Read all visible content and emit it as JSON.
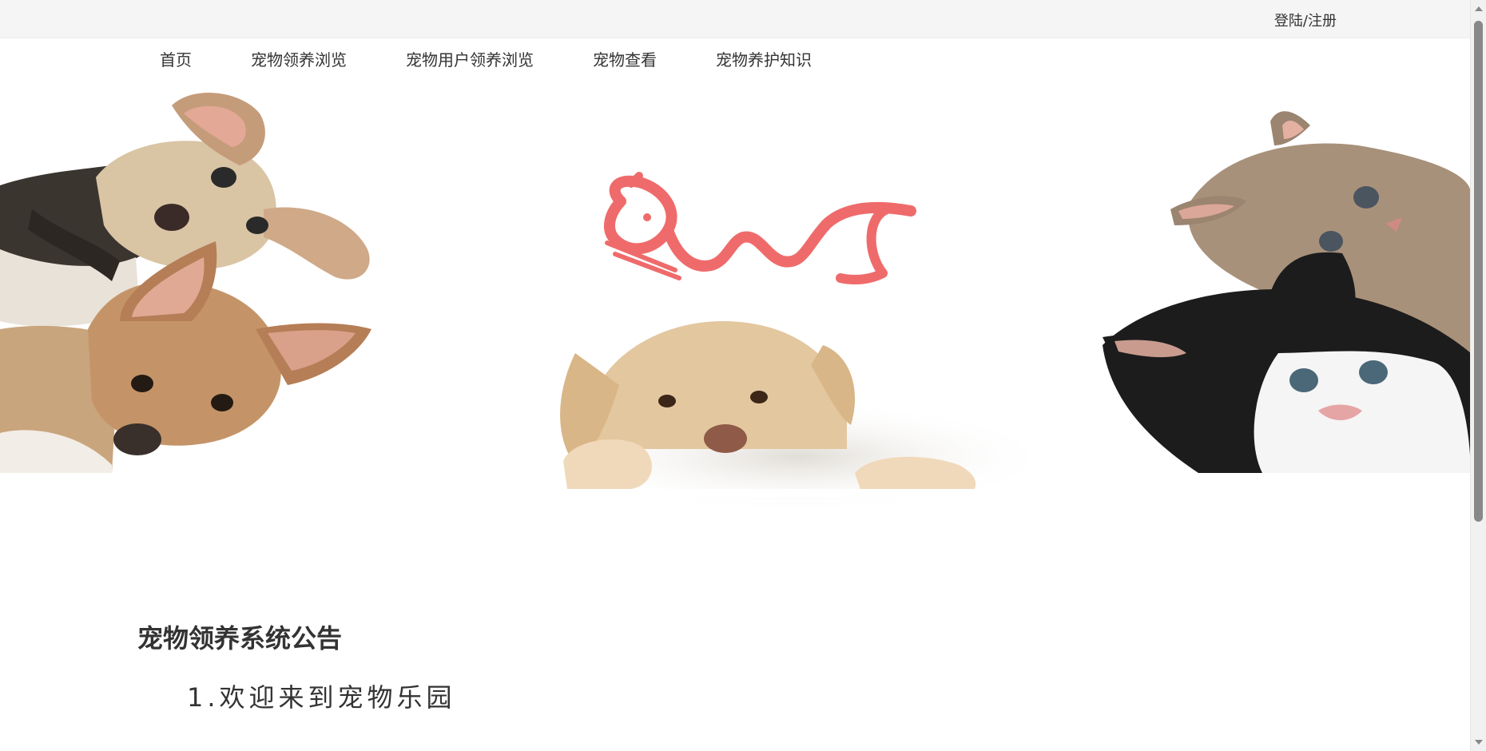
{
  "header": {
    "login_register": "登陆/注册"
  },
  "nav": {
    "items": [
      {
        "label": "首页"
      },
      {
        "label": "宠物领养浏览"
      },
      {
        "label": "宠物用户领养浏览"
      },
      {
        "label": "宠物查看"
      },
      {
        "label": "宠物养护知识"
      }
    ]
  },
  "banner": {
    "logo_icon": "cat-logo-icon",
    "logo_color": "#ef6b6b",
    "images": [
      "dog-image",
      "cat-image"
    ]
  },
  "notice": {
    "title": "宠物领养系统公告",
    "items": [
      {
        "text": "1.欢迎来到宠物乐园"
      }
    ]
  }
}
